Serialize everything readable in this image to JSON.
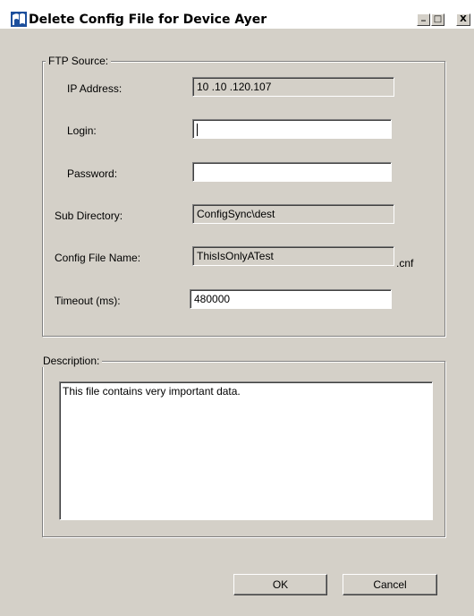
{
  "window": {
    "title": "Delete Config File for Device Ayer",
    "controls": {
      "minimize": "_",
      "maximize": "□",
      "close": "X"
    }
  },
  "ftp_source": {
    "group_label": "FTP Source:",
    "ip_address": {
      "label": "IP Address:",
      "value": "10 .10 .120.107"
    },
    "login": {
      "label": "Login:",
      "value": ""
    },
    "password": {
      "label": "Password:",
      "value": ""
    },
    "sub_directory": {
      "label": "Sub Directory:",
      "value": "ConfigSync\\dest"
    },
    "config_file_name": {
      "label": "Config File Name:",
      "value": "ThisIsOnlyATest",
      "suffix": ".cnf"
    },
    "timeout": {
      "label": "Timeout (ms):",
      "value": "480000"
    }
  },
  "description": {
    "group_label": "Description:",
    "text": "This file contains very important data."
  },
  "buttons": {
    "ok": "OK",
    "cancel": "Cancel"
  },
  "colors": {
    "dialog_bg": "#d4d0c8",
    "field_bg": "#ffffff",
    "readonly_bg": "#d4d0c8"
  }
}
